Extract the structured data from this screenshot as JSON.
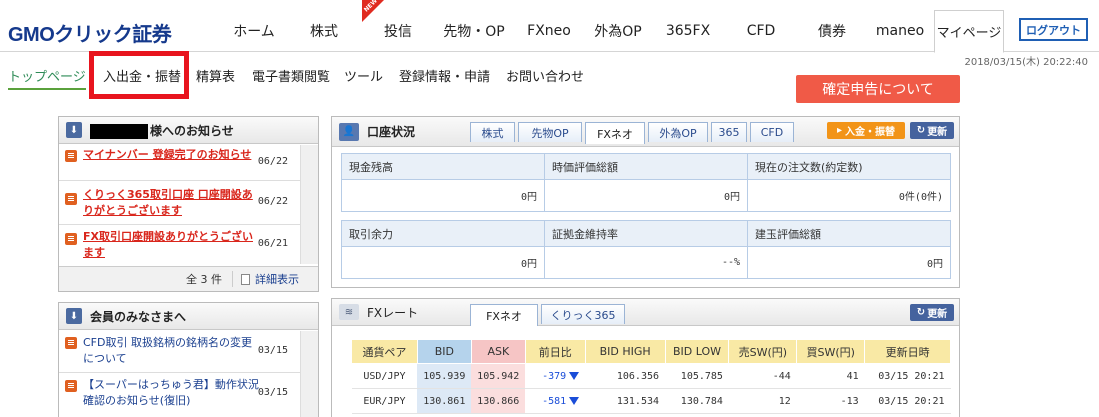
{
  "header": {
    "logo": {
      "gmo": "GMO",
      "click": "クリック",
      "shoken": "証券"
    },
    "nav": [
      {
        "label": "ホーム"
      },
      {
        "label": "株式"
      },
      {
        "label": "投信",
        "badge": "NEW"
      },
      {
        "label": "先物・OP"
      },
      {
        "label": "FXneo"
      },
      {
        "label": "外為OP"
      },
      {
        "label": "365FX"
      },
      {
        "label": "CFD"
      },
      {
        "label": "債券"
      },
      {
        "label": "maneo"
      },
      {
        "label": "マイページ"
      }
    ],
    "logout": "ログアウト",
    "datetime": "2018/03/15(木) 20:22:40"
  },
  "subnav": [
    {
      "label": "トップページ"
    },
    {
      "label": "入出金・振替"
    },
    {
      "label": "精算表"
    },
    {
      "label": "電子書類閲覧"
    },
    {
      "label": "ツール"
    },
    {
      "label": "登録情報・申請"
    },
    {
      "label": "お問い合わせ"
    }
  ],
  "kakutei_button": "確定申告について",
  "notices": {
    "title_suffix": "様へのお知らせ",
    "items": [
      {
        "text": "マイナンバー 登録完了のお知らせ",
        "date": "06/22"
      },
      {
        "text": "くりっく365取引口座 口座開設ありがとうございます",
        "date": "06/22"
      },
      {
        "text": "FX取引口座開設ありがとうございます",
        "date": "06/21"
      }
    ],
    "count": "全 3 件",
    "detail": "詳細表示"
  },
  "members": {
    "title": "会員のみなさまへ",
    "items": [
      {
        "text": "CFD取引 取扱銘柄の銘柄名の変更について",
        "date": "03/15"
      },
      {
        "text": "【スーパーはっちゅう君】動作状況確認のお知らせ(復旧)",
        "date": "03/15"
      }
    ]
  },
  "account": {
    "title": "口座状況",
    "tabs": [
      "株式",
      "先物OP",
      "FXネオ",
      "外為OP",
      "365",
      "CFD"
    ],
    "active_tab": "FXネオ",
    "deposit_button": "入金・振替",
    "refresh_button": "更新",
    "cells": [
      {
        "label": "現金残高",
        "value": "0円"
      },
      {
        "label": "時価評価総額",
        "value": "0円"
      },
      {
        "label": "現在の注文数(約定数)",
        "value": "0件(0件)"
      },
      {
        "label": "取引余力",
        "value": "0円"
      },
      {
        "label": "証拠金維持率",
        "value": "--%"
      },
      {
        "label": "建玉評価総額",
        "value": "0円"
      }
    ]
  },
  "fxrate": {
    "title": "FXレート",
    "tabs": [
      "FXネオ",
      "くりっく365"
    ],
    "refresh_button": "更新",
    "columns": [
      "通貨ペア",
      "BID",
      "ASK",
      "前日比",
      "BID HIGH",
      "BID LOW",
      "売SW(円)",
      "買SW(円)",
      "更新日時"
    ],
    "rows": [
      {
        "pair": "USD/JPY",
        "bid": "105.939",
        "ask": "105.942",
        "change": "-379",
        "high": "106.356",
        "low": "105.785",
        "sell_sw": "-44",
        "buy_sw": "41",
        "time": "03/15 20:21"
      },
      {
        "pair": "EUR/JPY",
        "bid": "130.861",
        "ask": "130.866",
        "change": "-581",
        "high": "131.534",
        "low": "130.784",
        "sell_sw": "12",
        "buy_sw": "-13",
        "time": "03/15 20:21"
      }
    ]
  }
}
